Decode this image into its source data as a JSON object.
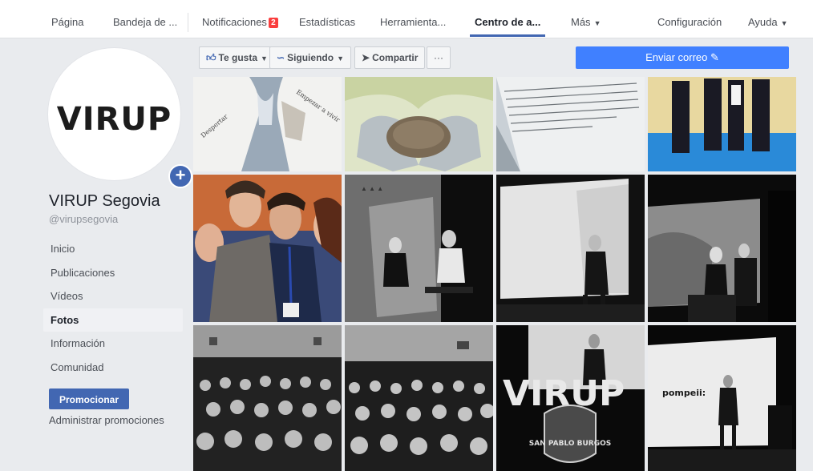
{
  "topnav": {
    "items": [
      {
        "label": "Página"
      },
      {
        "label": "Bandeja de ..."
      },
      {
        "label": "Notificaciones",
        "badge": "2"
      },
      {
        "label": "Estadísticas"
      },
      {
        "label": "Herramienta..."
      },
      {
        "label": "Centro de a...",
        "active": true
      },
      {
        "label": "Más"
      },
      {
        "label": "Configuración"
      },
      {
        "label": "Ayuda"
      }
    ]
  },
  "profile": {
    "logo_text": "VIRUP",
    "name": "VIRUP Segovia",
    "handle": "@virupsegovia"
  },
  "sidenav": {
    "items": [
      {
        "label": "Inicio"
      },
      {
        "label": "Publicaciones"
      },
      {
        "label": "Vídeos"
      },
      {
        "label": "Fotos",
        "active": true
      },
      {
        "label": "Información"
      },
      {
        "label": "Comunidad"
      }
    ],
    "promote_label": "Promocionar",
    "admin_promos_label": "Administrar promociones"
  },
  "actions": {
    "like_label": "Te gusta",
    "follow_label": "Siguiendo",
    "share_label": "Compartir",
    "more_label": "···",
    "send_label": "Enviar correo"
  },
  "photos": {
    "row3_logo_text": "VIRUP",
    "row3_badge_text": "SAN PABLO BURGOS",
    "row3_pompeii_text": "pompeii:"
  },
  "colors": {
    "brand_blue": "#4267b2",
    "send_blue": "#4080ff",
    "badge_red": "#fa3e3e"
  }
}
